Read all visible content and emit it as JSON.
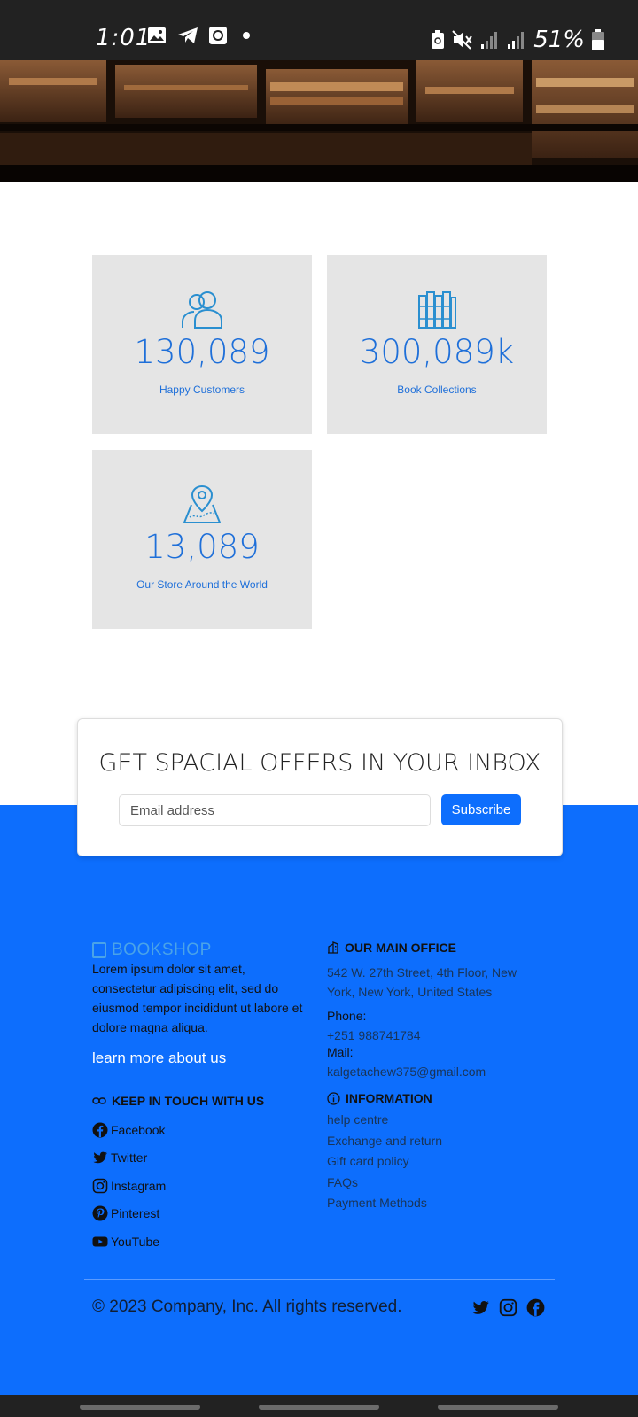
{
  "status_bar": {
    "time": "1:01",
    "battery": "51%",
    "icons_left": [
      "image-icon",
      "telegram-icon",
      "app-icon",
      "dot-icon"
    ],
    "icons_right": [
      "battery-saver-icon",
      "mute-icon",
      "signal-icon",
      "signal-icon",
      "battery-icon"
    ]
  },
  "hero": {
    "image": "bookshelf-photo"
  },
  "stats": [
    {
      "icon": "users-icon",
      "value": "130,089",
      "label": "Happy Customers"
    },
    {
      "icon": "books-icon",
      "value": "300,089k",
      "label": "Book Collections"
    },
    {
      "icon": "map-pin-icon",
      "value": "13,089",
      "label": "Our Store Around the World"
    }
  ],
  "newsletter": {
    "title": "GET SPACIAL OFFERS IN YOUR INBOX",
    "email_placeholder": "Email address",
    "subscribe_label": "Subscribe"
  },
  "footer": {
    "brand": "BOOKSHOP",
    "about": "Lorem ipsum dolor sit amet, consectetur adipiscing elit, sed do eiusmod tempor incididunt ut labore et dolore magna aliqua.",
    "learn_more": "learn more about us",
    "keep_in_touch_heading": "KEEP IN TOUCH WITH US",
    "social": [
      {
        "icon": "facebook-icon",
        "label": "Facebook"
      },
      {
        "icon": "twitter-icon",
        "label": "Twitter"
      },
      {
        "icon": "instagram-icon",
        "label": "Instagram"
      },
      {
        "icon": "pinterest-icon",
        "label": "Pinterest"
      },
      {
        "icon": "youtube-icon",
        "label": "YouTube"
      }
    ],
    "office_heading": "OUR MAIN OFFICE",
    "office_address": "542 W. 27th Street, 4th Floor, New York, New York, United States",
    "phone_label": "Phone:",
    "phone": "+251 988741784",
    "mail_label": "Mail:",
    "mail": "kalgetachew375@gmail.com",
    "information_heading": "INFORMATION",
    "information_links": [
      "help centre",
      "Exchange and return",
      "Gift card policy",
      "FAQs",
      "Payment Methods"
    ],
    "copyright": "© 2023 Company, Inc. All rights reserved.",
    "bottom_social": [
      "twitter-icon",
      "instagram-icon",
      "facebook-icon"
    ]
  },
  "colors": {
    "accent": "#0d6efd",
    "stat_text": "#1e6fd9",
    "card_bg": "#e5e5e5",
    "brand": "#4aa3e8",
    "status_bar": "#222222"
  }
}
